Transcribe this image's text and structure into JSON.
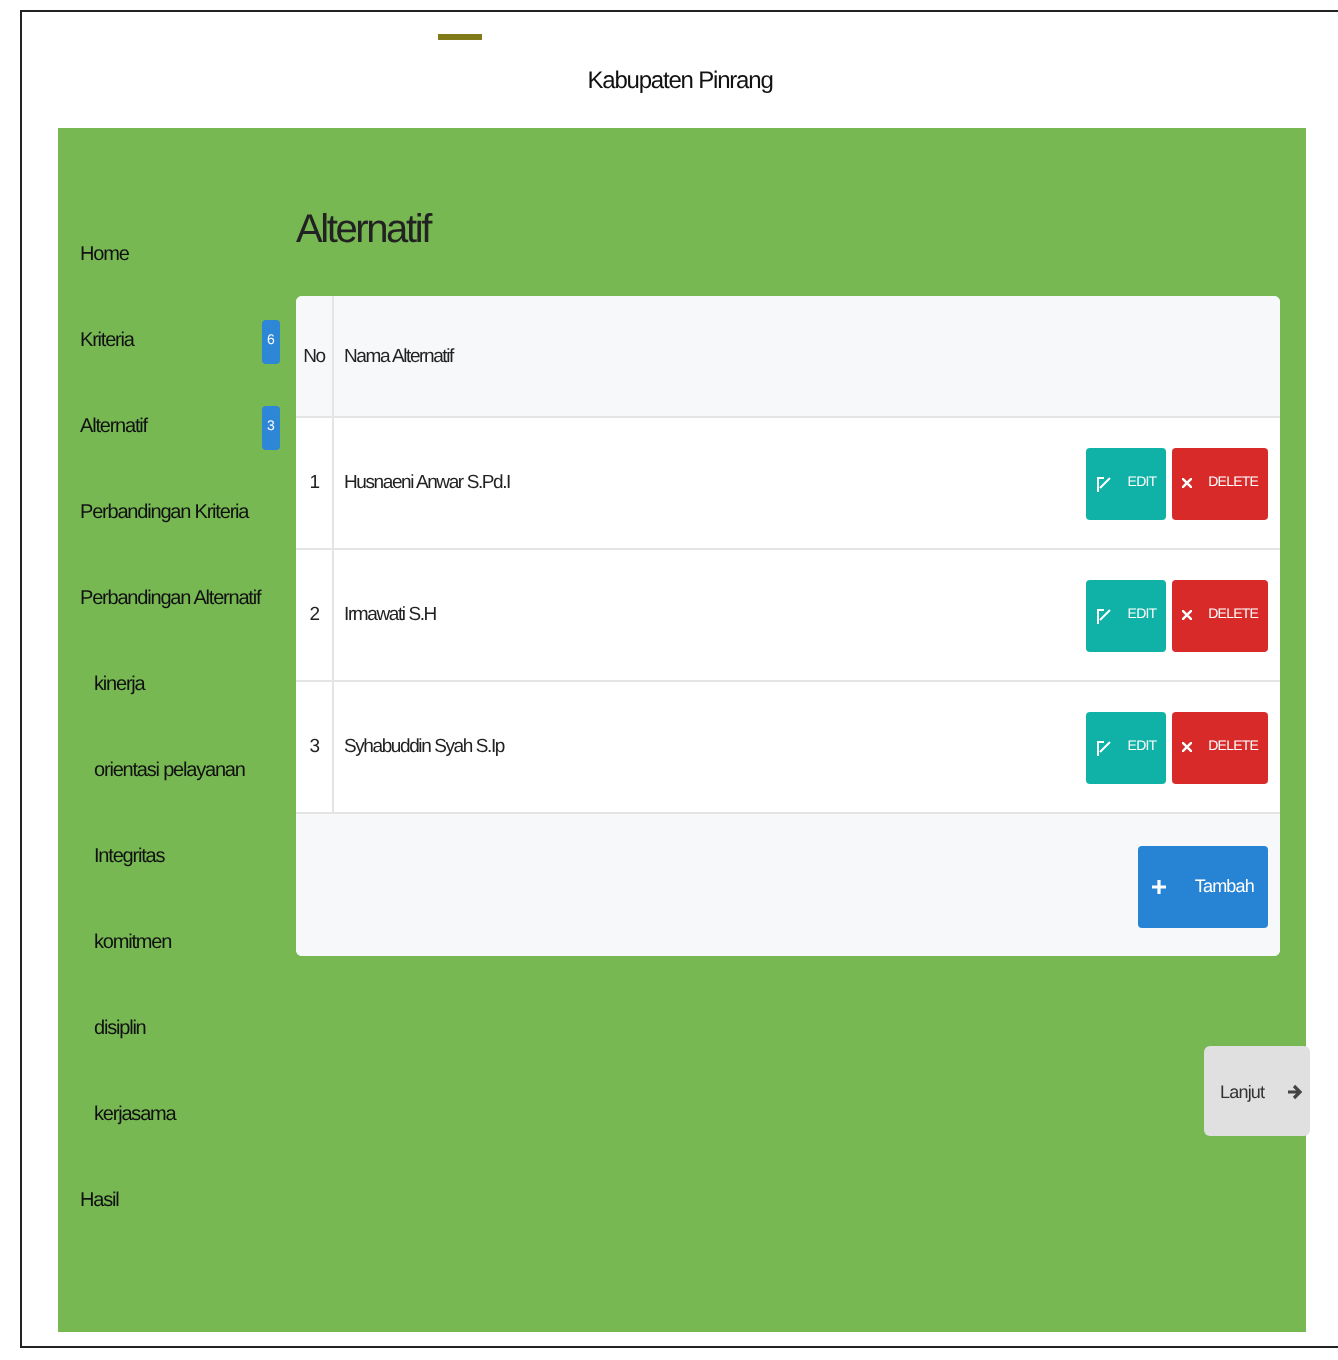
{
  "header": {
    "title": "Kabupaten Pinrang"
  },
  "sidebar": {
    "items": [
      {
        "label": "Home"
      },
      {
        "label": "Kriteria",
        "badge": "6"
      },
      {
        "label": "Alternatif",
        "badge": "3"
      },
      {
        "label": "Perbandingan Kriteria"
      },
      {
        "label": "Perbandingan Alternatif",
        "children": [
          {
            "label": "kinerja"
          },
          {
            "label": "orientasi pelayanan"
          },
          {
            "label": "Integritas"
          },
          {
            "label": "komitmen"
          },
          {
            "label": "disiplin"
          },
          {
            "label": "kerjasama"
          }
        ]
      },
      {
        "label": "Hasil"
      }
    ]
  },
  "page_title": "Alternatif",
  "table": {
    "columns": [
      "No",
      "Nama Alternatif"
    ],
    "rows": [
      {
        "no": "1",
        "name": "Husnaeni Anwar S.Pd.I",
        "edit": "EDIT",
        "delete": "DELETE"
      },
      {
        "no": "2",
        "name": "Irmawati S.H",
        "edit": "EDIT",
        "delete": "DELETE"
      },
      {
        "no": "3",
        "name": "Syhabuddin Syah S.Ip",
        "edit": "EDIT",
        "delete": "DELETE"
      }
    ],
    "add_button": "Tambah"
  },
  "next_button": "Lanjut"
}
